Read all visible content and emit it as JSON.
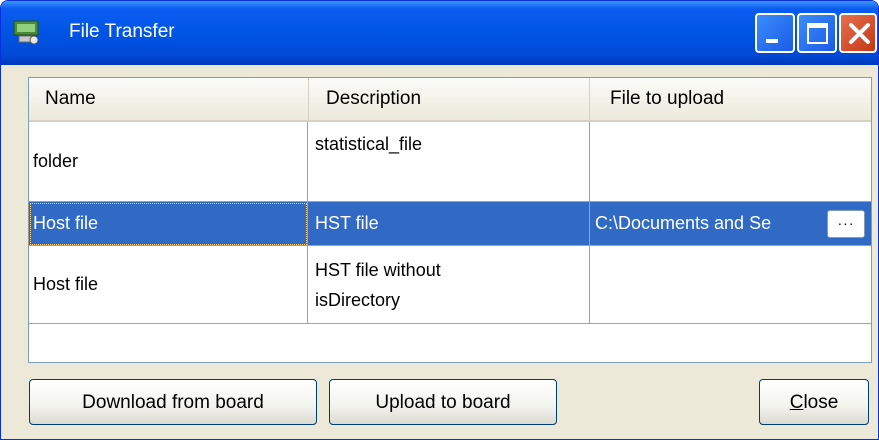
{
  "window": {
    "title": "File Transfer",
    "icons": {
      "app": "board-transfer-icon",
      "minimize": "minimize-icon",
      "maximize": "maximize-icon",
      "close": "close-icon"
    },
    "colors": {
      "titlebar": "#0055e5",
      "selection": "#316ac5",
      "face": "#ece9d8"
    }
  },
  "table": {
    "columns": [
      "Name",
      "Description",
      "File to upload"
    ],
    "rows": [
      {
        "name": "folder",
        "description": "statistical_file",
        "file": ""
      },
      {
        "name": "Host file",
        "description": "HST file",
        "file": "C:\\Documents and Se",
        "browse_label": "···",
        "selected": true
      },
      {
        "name": "Host file",
        "description_line1": "HST file without",
        "description_line2": "isDirectory",
        "file": ""
      }
    ]
  },
  "buttons": {
    "download": "Download from board",
    "upload": "Upload to board",
    "close": "Close"
  }
}
